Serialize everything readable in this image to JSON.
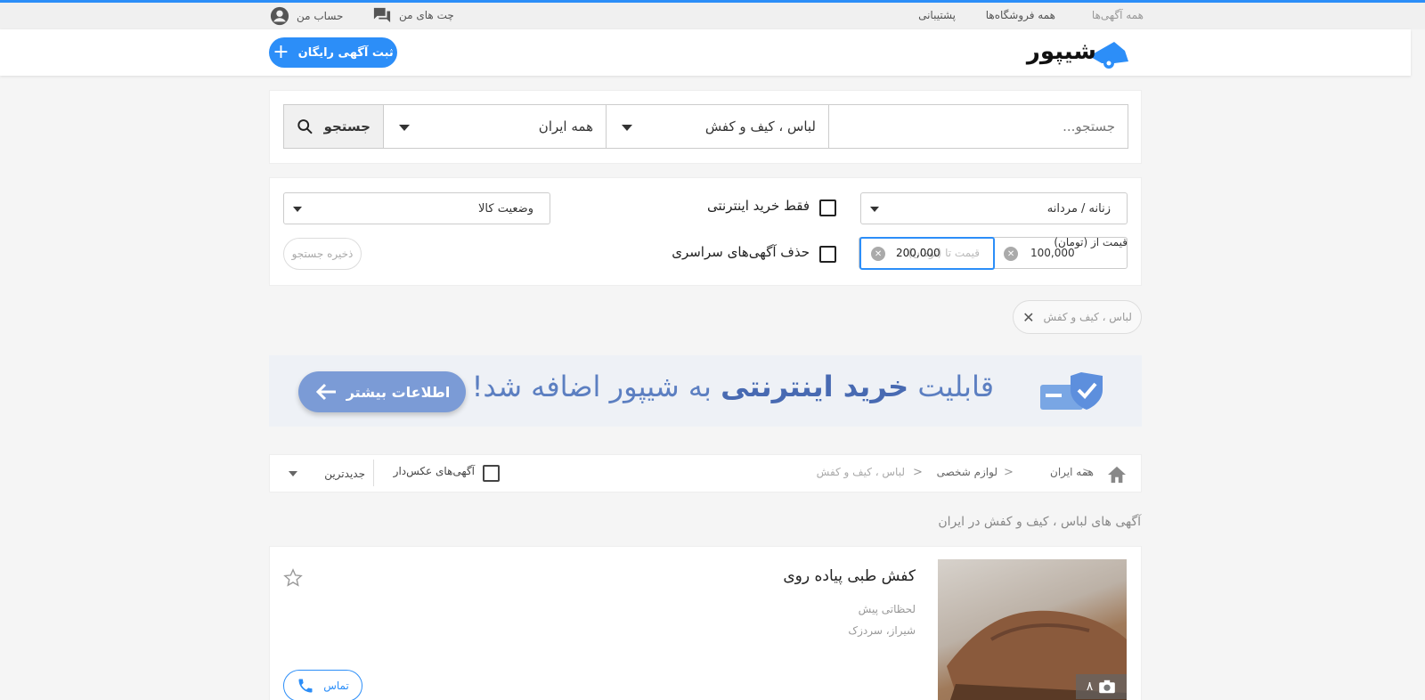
{
  "topbar": {
    "all_ads": "همه آگهی‌ها",
    "all_stores": "همه فروشگاه‌ها",
    "support": "پشتیبانی",
    "chats": "چت های من",
    "account": "حساب من"
  },
  "header": {
    "logo_text": "شیپور",
    "post_ad": "ثبت آگهی رایگان"
  },
  "search": {
    "placeholder": "جستجو...",
    "category": "لباس ، کیف و کفش",
    "location": "همه ایران",
    "button": "جستجو"
  },
  "filters": {
    "gender": "زنانه / مردانه",
    "online_only": "فقط خرید اینترنتی",
    "condition": "وضعیت کالا",
    "price_from_label": "قیمت از (تومان)",
    "price_from_value": "100,000",
    "price_to_placeholder": "قیمت تا (تومان)",
    "price_to_value": "200,000",
    "remove_nationwide": "حذف آگهی‌های سراسری",
    "save_search": "ذخیره جستجو"
  },
  "chip": {
    "label": "لباس ، کیف و کفش"
  },
  "banner": {
    "text_pre": "قابلیت ",
    "text_bold": "خرید اینترنتی",
    "text_post": " به شیپور اضافه شد!",
    "button": "اطلاعات بیشتر"
  },
  "breadcrumbs": [
    "همه ایران",
    "لوازم شخصی",
    "لباس ، کیف و کفش"
  ],
  "sort": {
    "photo_only": "آگهی‌های عکس‌دار",
    "order": "جدیدترین"
  },
  "results_title": "آگهی های لباس ، کیف و کفش در ایران",
  "listings": [
    {
      "title": "کفش طبی پیاده روی",
      "time": "لحظاتی پیش",
      "location": "شیراز، سردزک",
      "photo_count": "۸",
      "contact": "تماس"
    }
  ],
  "colors": {
    "accent": "#2c8ef8",
    "banner_text": "#5c7fc1"
  }
}
